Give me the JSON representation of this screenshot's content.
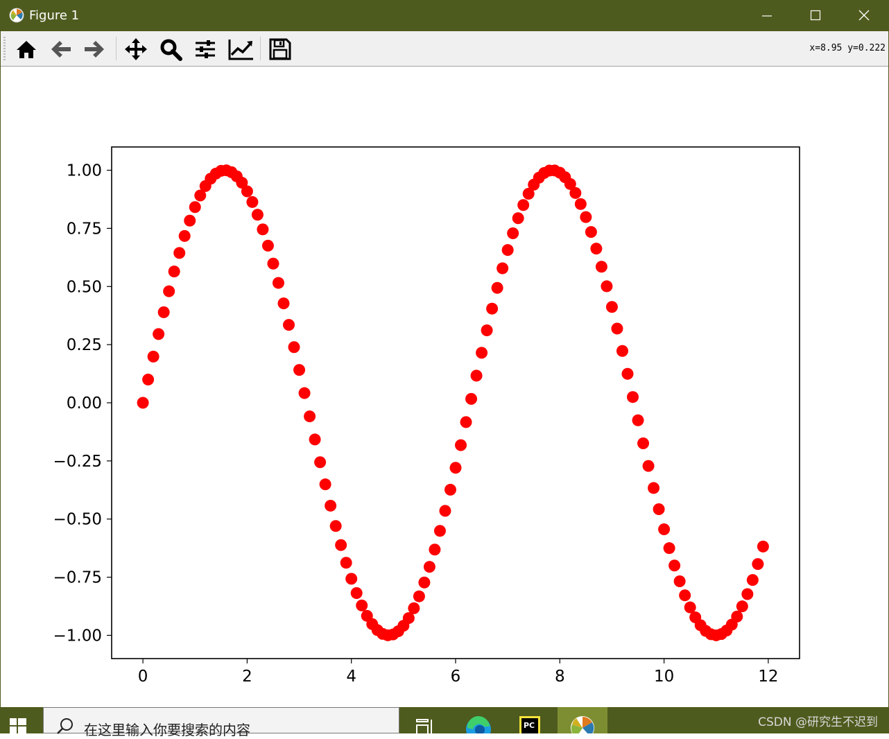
{
  "window": {
    "title": "Figure 1",
    "controls": [
      "minimize",
      "maximize",
      "close"
    ]
  },
  "toolbar": {
    "buttons": [
      {
        "icon": "home-icon",
        "label": "Home"
      },
      {
        "icon": "back-arrow-icon",
        "label": "Back"
      },
      {
        "icon": "forward-arrow-icon",
        "label": "Forward"
      },
      {
        "icon": "pan-icon",
        "label": "Pan"
      },
      {
        "icon": "zoom-icon",
        "label": "Zoom"
      },
      {
        "icon": "configure-subplots-icon",
        "label": "Subplots"
      },
      {
        "icon": "edit-axis-icon",
        "label": "Customize"
      },
      {
        "icon": "save-icon",
        "label": "Save"
      }
    ],
    "coords": "x=8.95  y=0.222"
  },
  "chart_data": {
    "type": "scatter",
    "title": "",
    "xlabel": "",
    "ylabel": "",
    "x_start": 0,
    "x_step": 0.1,
    "x_end": 12,
    "function": "sin(x)",
    "marker_color": "#ff0000",
    "marker": "circle",
    "xlim": [
      -0.6,
      12.6
    ],
    "ylim": [
      -1.1,
      1.1
    ],
    "xticks": [
      0,
      2,
      4,
      6,
      8,
      10,
      12
    ],
    "xtick_labels": [
      "0",
      "2",
      "4",
      "6",
      "8",
      "10",
      "12"
    ],
    "yticks": [
      1.0,
      0.75,
      0.5,
      0.25,
      0.0,
      -0.25,
      -0.5,
      -0.75,
      -1.0
    ],
    "ytick_labels": [
      "1.00",
      "0.75",
      "0.50",
      "0.25",
      "0.00",
      "−0.25",
      "−0.50",
      "−0.75",
      "−1.00"
    ],
    "grid": false,
    "legend": "none"
  },
  "taskbar": {
    "search_placeholder": "在这里输入你要搜索的内容",
    "items": [
      "task-view-icon",
      "edge-icon",
      "pycharm-icon",
      "matplotlib-icon"
    ],
    "watermark": "CSDN @研究生不迟到"
  }
}
